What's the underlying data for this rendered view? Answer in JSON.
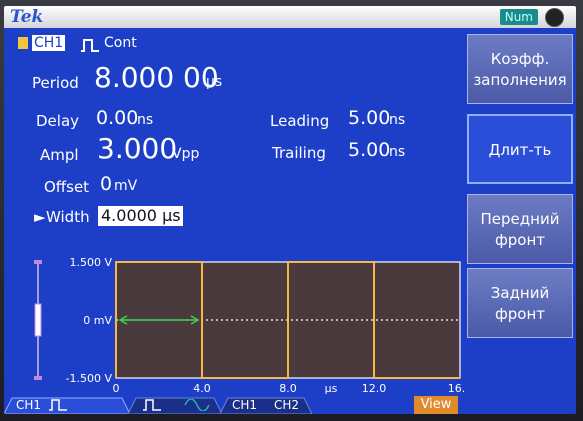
{
  "brand": "Tek",
  "status": {
    "num_key": "Num"
  },
  "channel": {
    "label": "CH1",
    "mode": "Cont",
    "badge_color": "#f4c542"
  },
  "params": {
    "period": {
      "label": "Period",
      "value": "8.000 00",
      "unit": "µs"
    },
    "delay": {
      "label": "Delay",
      "value": "0.00",
      "unit": "ns"
    },
    "ampl": {
      "label": "Ampl",
      "value": "3.000",
      "unit": "Vpp"
    },
    "offset": {
      "label": "Offset",
      "value": "0",
      "unit": "mV"
    },
    "width": {
      "label": "Width",
      "value": "4.0000 µs"
    },
    "leading": {
      "label": "Leading",
      "value": "5.00",
      "unit": "ns"
    },
    "trailing": {
      "label": "Trailing",
      "value": "5.00",
      "unit": "ns"
    }
  },
  "softkeys": [
    {
      "line1": "Коэфф.",
      "line2": "заполнения",
      "active": false
    },
    {
      "line1": "Длит-ть",
      "line2": "",
      "active": true
    },
    {
      "line1": "Передний",
      "line2": "фронт",
      "active": false
    },
    {
      "line1": "Задний",
      "line2": "фронт",
      "active": false
    }
  ],
  "chart_data": {
    "type": "line",
    "x_ticks": [
      "0",
      "4.0",
      "8.0",
      "12.0",
      "16.0"
    ],
    "xunit": "µs",
    "y_ticks": [
      "1.500 V",
      "0 mV",
      "-1.500 V"
    ],
    "xlim": [
      0,
      16
    ],
    "ylim": [
      -1.5,
      1.5
    ],
    "series": [
      {
        "x": [
          0,
          0,
          4,
          4,
          8,
          8,
          12,
          12,
          16
        ],
        "y": [
          -1.5,
          1.5,
          1.5,
          -1.5,
          -1.5,
          1.5,
          1.5,
          -1.5,
          -1.5
        ],
        "color": "#f4b942"
      }
    ],
    "width_marker": {
      "x_start": 0,
      "x_end": 4,
      "y": 0,
      "color": "#3ad24a"
    }
  },
  "tabs": {
    "ch1": "CH1",
    "ch1b": "CH1",
    "ch2": "CH2",
    "view": "View"
  }
}
